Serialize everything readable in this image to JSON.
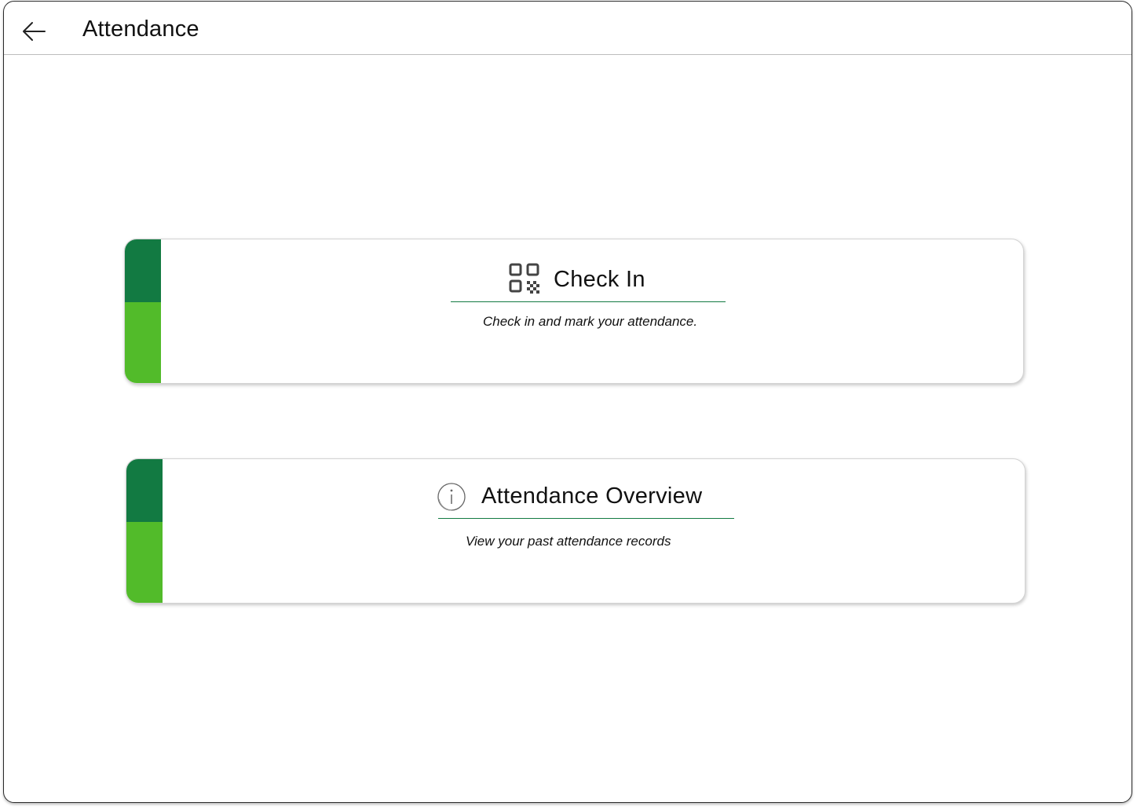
{
  "header": {
    "title": "Attendance",
    "back_icon": "arrow-left-icon"
  },
  "colors": {
    "accent_dark": "#127a42",
    "accent_light": "#52bb2a",
    "underline": "#127a42"
  },
  "cards": [
    {
      "title": "Check In",
      "description": "Check in and mark your attendance.",
      "icon": "qr-code-icon"
    },
    {
      "title": "Attendance Overview",
      "description": "View your past attendance records",
      "icon": "info-icon"
    }
  ]
}
